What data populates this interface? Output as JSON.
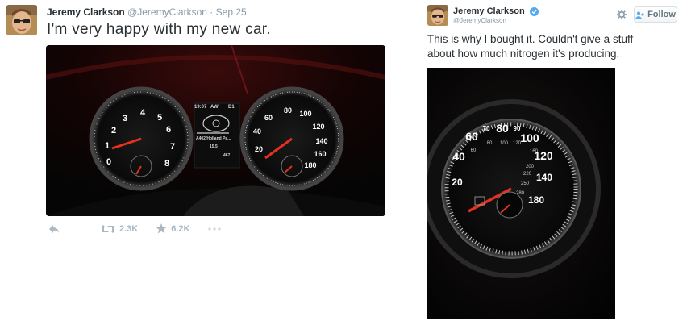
{
  "left_tweet": {
    "author_name": "Jeremy Clarkson",
    "handle": "@JeremyClarkson",
    "separator": "·",
    "timestamp": "Sep 25",
    "text": "I'm very happy with my new car.",
    "retweets": "2.3K",
    "favorites": "6.2K",
    "dash": {
      "tach_labels": [
        "0",
        "1",
        "2",
        "3",
        "4",
        "5",
        "6",
        "7",
        "8"
      ],
      "speedo_labels": [
        "20",
        "40",
        "60",
        "80",
        "100",
        "120",
        "140",
        "160",
        "180"
      ],
      "clock": "19:07",
      "gear": "AW",
      "odo_label": "D1",
      "route": "A402/Holland Pa...",
      "trip": "15.5",
      "odometer": "467"
    }
  },
  "right_tweet": {
    "author_name": "Jeremy Clarkson",
    "handle": "@JeremyClarkson",
    "follow_label": "Follow",
    "text_line1": "This is why I bought it. Couldn't give a stuff",
    "text_line2": "about how much nitrogen it's producing.",
    "gauge_major": [
      "40",
      "60",
      "80",
      "100",
      "120"
    ],
    "gauge_outer": [
      "20",
      "70",
      "90",
      "140",
      "180"
    ],
    "gauge_inner": [
      "60",
      "80",
      "100",
      "120",
      "160",
      "200",
      "220",
      "250",
      "280"
    ]
  },
  "colors": {
    "text": "#292f33",
    "muted": "#8899a6",
    "verified": "#55acee",
    "needle": "#e0321e"
  }
}
